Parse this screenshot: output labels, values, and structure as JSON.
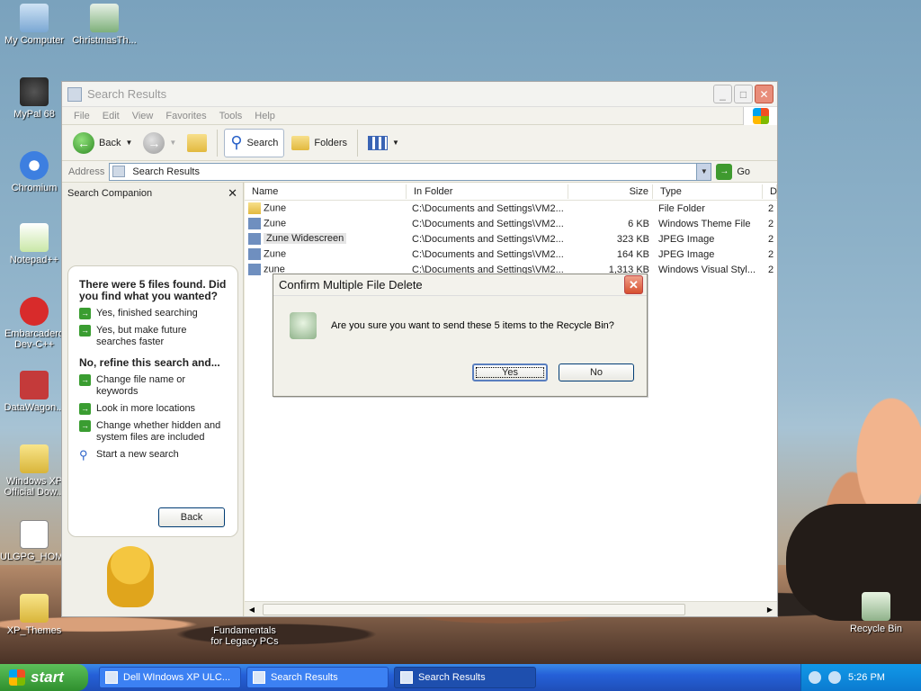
{
  "desktop": {
    "icons": [
      {
        "label": "My Computer",
        "icon": "my-computer-icon"
      },
      {
        "label": "ChristmasTh...",
        "icon": "christmas-theme-icon"
      },
      {
        "label": "MyPal 68",
        "icon": "mypal-icon"
      },
      {
        "label": "Chromium",
        "icon": "chromium-icon"
      },
      {
        "label": "Notepad++",
        "icon": "notepad-plus-icon"
      },
      {
        "label": "Embarcadero Dev-C++",
        "icon": "devcpp-icon"
      },
      {
        "label": "DataWagon...",
        "icon": "datawagon-icon"
      },
      {
        "label": "Windows XP Official Dow...",
        "icon": "zip-folder-icon"
      },
      {
        "label": "ULGPG_HOM...",
        "icon": "document-icon"
      },
      {
        "label": "XP_Themes",
        "icon": "zip-folder-icon"
      },
      {
        "label": "Fundamentals for Legacy PCs",
        "icon": "shortcut-icon"
      },
      {
        "label": "Recycle Bin",
        "icon": "recycle-bin-icon"
      }
    ]
  },
  "window": {
    "title": "Search Results",
    "menu": [
      "File",
      "Edit",
      "View",
      "Favorites",
      "Tools",
      "Help"
    ],
    "toolbar": {
      "back": "Back",
      "search": "Search",
      "folders": "Folders"
    },
    "address": {
      "label": "Address",
      "value": "Search Results",
      "go": "Go"
    },
    "companion": {
      "title": "Search Companion",
      "heading": "There were 5 files found. Did you find what you wanted?",
      "opt1": "Yes, finished searching",
      "opt2": "Yes, but make future searches faster",
      "refine": "No, refine this search and...",
      "opt3": "Change file name or keywords",
      "opt4": "Look in more locations",
      "opt5": "Change whether hidden and system files are included",
      "opt6": "Start a new search",
      "back": "Back"
    },
    "columns": [
      "Name",
      "In Folder",
      "Size",
      "Type",
      "D"
    ],
    "rows": [
      {
        "name": "Zune",
        "folder": "C:\\Documents and Settings\\VM2...",
        "size": "",
        "type": "File Folder",
        "d": "2"
      },
      {
        "name": "Zune",
        "folder": "C:\\Documents and Settings\\VM2...",
        "size": "6 KB",
        "type": "Windows Theme File",
        "d": "2"
      },
      {
        "name": "Zune Widescreen",
        "folder": "C:\\Documents and Settings\\VM2...",
        "size": "323 KB",
        "type": "JPEG Image",
        "d": "2"
      },
      {
        "name": "Zune",
        "folder": "C:\\Documents and Settings\\VM2...",
        "size": "164 KB",
        "type": "JPEG Image",
        "d": "2"
      },
      {
        "name": "zune",
        "folder": "C:\\Documents and Settings\\VM2...",
        "size": "1,313 KB",
        "type": "Windows Visual Styl...",
        "d": "2"
      }
    ]
  },
  "dialog": {
    "title": "Confirm Multiple File Delete",
    "message": "Are you sure you want to send these 5 items to the Recycle Bin?",
    "yes": "Yes",
    "no": "No"
  },
  "taskbar": {
    "start": "start",
    "tasks": [
      "Dell WIndows XP ULC...",
      "Search Results",
      "Search Results"
    ],
    "clock": "5:26 PM"
  }
}
